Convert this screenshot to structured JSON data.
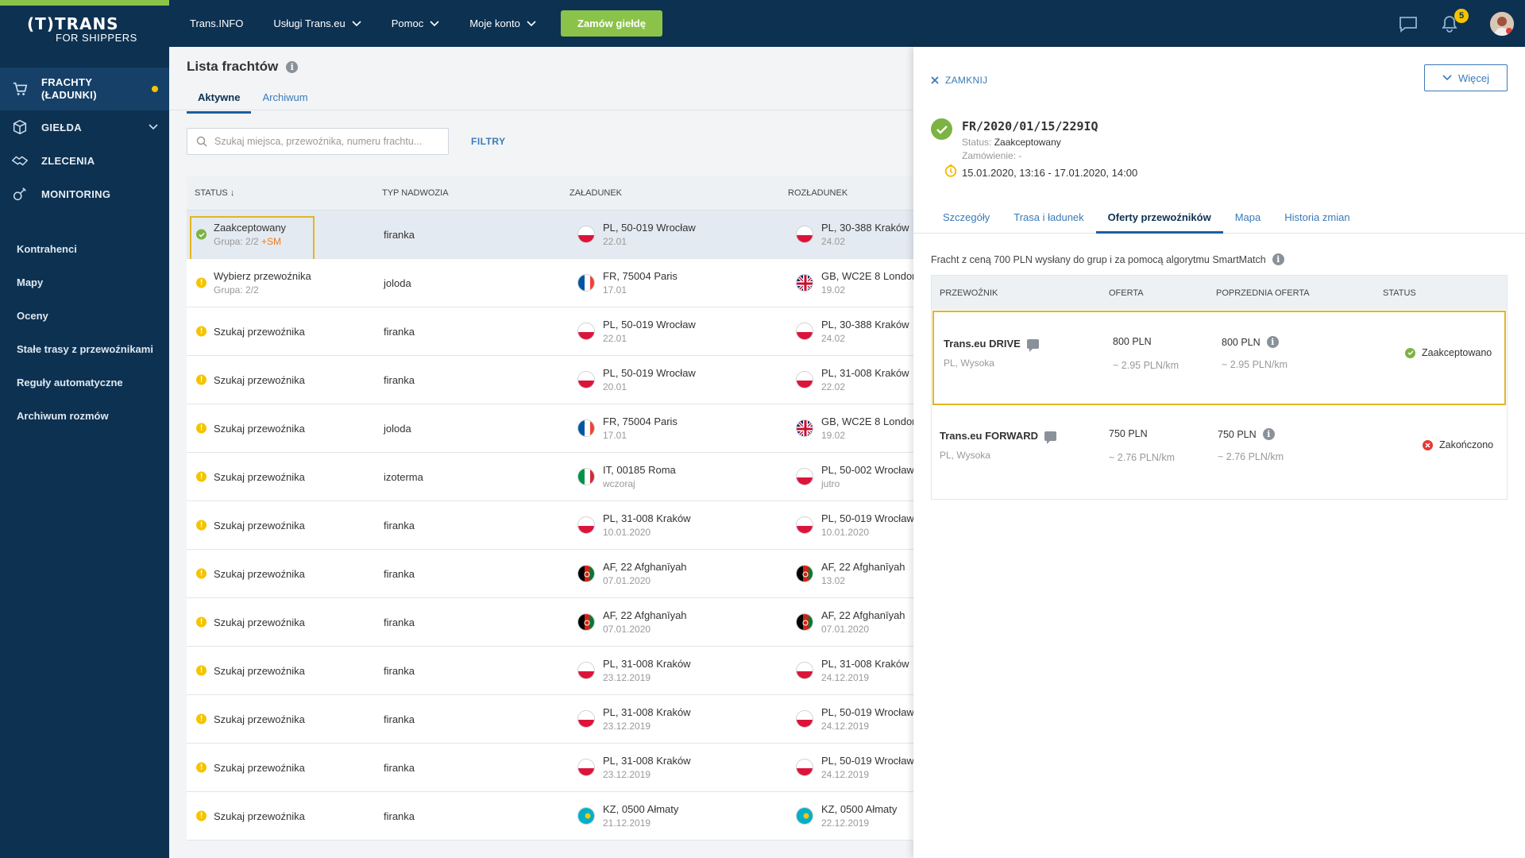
{
  "app": {
    "logo_main": "(T)TRANS",
    "logo_sub": "FOR SHIPPERS"
  },
  "topbar": {
    "nav": [
      {
        "label": "Trans.INFO",
        "has_menu": false
      },
      {
        "label": "Usługi Trans.eu",
        "has_menu": true
      },
      {
        "label": "Pomoc",
        "has_menu": true
      },
      {
        "label": "Moje konto",
        "has_menu": true
      }
    ],
    "order_button": "Zamów giełdę",
    "notifications_count": "5"
  },
  "sidebar": {
    "main": [
      {
        "label": "FRACHTY (ŁADUNKI)",
        "icon": "cart-icon",
        "active": true
      },
      {
        "label": "GIEŁDA",
        "icon": "box-icon"
      },
      {
        "label": "ZLECENIA",
        "icon": "handshake-icon"
      },
      {
        "label": "MONITORING",
        "icon": "satellite-icon"
      }
    ],
    "sub": [
      "Kontrahenci",
      "Mapy",
      "Oceny",
      "Stałe trasy z przewoźnikami",
      "Reguły automatyczne",
      "Archiwum rozmów"
    ]
  },
  "list": {
    "title": "Lista frachtów",
    "tabs": [
      "Aktywne",
      "Archiwum"
    ],
    "search_placeholder": "Szukaj miejsca, przewoźnika, numeru frachtu...",
    "filters_label": "FILTRY",
    "columns": [
      "STATUS ↓",
      "TYP NADWOZIA",
      "ZAŁADUNEK",
      "ROZŁADUNEK"
    ],
    "rows": [
      {
        "status": "Zaakceptowany",
        "group": "Grupa: 2/2",
        "sm": " +SM",
        "ok": true,
        "body": "firanka",
        "from_flag": "PL",
        "from": "PL, 50-019 Wrocław",
        "from_date": "22.01",
        "to_flag": "PL",
        "to": "PL, 30-388 Kraków",
        "to_date": "24.02"
      },
      {
        "status": "Wybierz przewoźnika",
        "group": "Grupa: 2/2",
        "sm": "",
        "ok": false,
        "body": "joloda",
        "from_flag": "FR",
        "from": "FR, 75004 Paris",
        "from_date": "17.01",
        "to_flag": "GB",
        "to": "GB, WC2E 8 London",
        "to_date": "19.02"
      },
      {
        "status": "Szukaj przewoźnika",
        "group": "",
        "sm": "",
        "ok": false,
        "body": "firanka",
        "from_flag": "PL",
        "from": "PL, 50-019 Wrocław",
        "from_date": "22.01",
        "to_flag": "PL",
        "to": "PL, 30-388 Kraków",
        "to_date": "24.02"
      },
      {
        "status": "Szukaj przewoźnika",
        "group": "",
        "sm": "",
        "ok": false,
        "body": "firanka",
        "from_flag": "PL",
        "from": "PL, 50-019 Wrocław",
        "from_date": "20.01",
        "to_flag": "PL",
        "to": "PL, 31-008 Kraków",
        "to_date": "22.02"
      },
      {
        "status": "Szukaj przewoźnika",
        "group": "",
        "sm": "",
        "ok": false,
        "body": "joloda",
        "from_flag": "FR",
        "from": "FR, 75004 Paris",
        "from_date": "17.01",
        "to_flag": "GB",
        "to": "GB, WC2E 8 London",
        "to_date": "19.02"
      },
      {
        "status": "Szukaj przewoźnika",
        "group": "",
        "sm": "",
        "ok": false,
        "body": "izoterma",
        "from_flag": "IT",
        "from": "IT, 00185 Roma",
        "from_date": "wczoraj",
        "to_flag": "PL",
        "to": "PL, 50-002 Wrocław",
        "to_date": "jutro"
      },
      {
        "status": "Szukaj przewoźnika",
        "group": "",
        "sm": "",
        "ok": false,
        "body": "firanka",
        "from_flag": "PL",
        "from": "PL, 31-008 Kraków",
        "from_date": "10.01.2020",
        "to_flag": "PL",
        "to": "PL, 50-019 Wrocław",
        "to_date": "10.01.2020"
      },
      {
        "status": "Szukaj przewoźnika",
        "group": "",
        "sm": "",
        "ok": false,
        "body": "firanka",
        "from_flag": "AF",
        "from": "AF, 22 Afghanīyah",
        "from_date": "07.01.2020",
        "to_flag": "AF",
        "to": "AF, 22 Afghanīyah",
        "to_date": "13.02"
      },
      {
        "status": "Szukaj przewoźnika",
        "group": "",
        "sm": "",
        "ok": false,
        "body": "firanka",
        "from_flag": "AF",
        "from": "AF, 22 Afghanīyah",
        "from_date": "07.01.2020",
        "to_flag": "AF",
        "to": "AF, 22 Afghanīyah",
        "to_date": "07.01.2020"
      },
      {
        "status": "Szukaj przewoźnika",
        "group": "",
        "sm": "",
        "ok": false,
        "body": "firanka",
        "from_flag": "PL",
        "from": "PL, 31-008 Kraków",
        "from_date": "23.12.2019",
        "to_flag": "PL",
        "to": "PL, 31-008 Kraków",
        "to_date": "24.12.2019"
      },
      {
        "status": "Szukaj przewoźnika",
        "group": "",
        "sm": "",
        "ok": false,
        "body": "firanka",
        "from_flag": "PL",
        "from": "PL, 31-008 Kraków",
        "from_date": "23.12.2019",
        "to_flag": "PL",
        "to": "PL, 50-019 Wrocław",
        "to_date": "24.12.2019"
      },
      {
        "status": "Szukaj przewoźnika",
        "group": "",
        "sm": "",
        "ok": false,
        "body": "firanka",
        "from_flag": "PL",
        "from": "PL, 31-008 Kraków",
        "from_date": "23.12.2019",
        "to_flag": "PL",
        "to": "PL, 50-019 Wrocław",
        "to_date": "24.12.2019"
      },
      {
        "status": "Szukaj przewoźnika",
        "group": "",
        "sm": "",
        "ok": false,
        "body": "firanka",
        "from_flag": "KZ",
        "from": "KZ, 0500 Ałmaty",
        "from_date": "21.12.2019",
        "to_flag": "KZ",
        "to": "KZ, 0500 Ałmaty",
        "to_date": "22.12.2019"
      }
    ]
  },
  "panel": {
    "close_label": "ZAMKNIJ",
    "more_label": "Więcej",
    "freight_id": "FR/2020/01/15/229IQ",
    "status_label": "Status:",
    "status_value": "Zaakceptowany",
    "order_label": "Zamówienie: -",
    "dates": "15.01.2020, 13:16 - 17.01.2020, 14:00",
    "tabs": [
      "Szczegóły",
      "Trasa i ładunek",
      "Oferty przewoźników",
      "Mapa",
      "Historia zmian"
    ],
    "active_tab": 2,
    "note": "Fracht z ceną 700 PLN wysłany do grup i za pomocą algorytmu SmartMatch",
    "columns": [
      "PRZEWOŹNIK",
      "OFERTA",
      "POPRZEDNIA OFERTA",
      "STATUS"
    ],
    "offers": [
      {
        "carrier": "Trans.eu DRIVE",
        "location": "PL, Wysoka",
        "offer": "800  PLN",
        "offer_km": "~ 2.95  PLN/km",
        "prev": "800  PLN",
        "prev_km": "~ 2.95  PLN/km",
        "status": "Zaakceptowano",
        "accepted": true
      },
      {
        "carrier": "Trans.eu FORWARD",
        "location": "PL, Wysoka",
        "offer": "750  PLN",
        "offer_km": "~ 2.76  PLN/km",
        "prev": "750  PLN",
        "prev_km": "~ 2.76  PLN/km",
        "status": "Zakończono",
        "accepted": false
      }
    ]
  },
  "colors": {
    "navy": "#0d3151",
    "green": "#8bc34a",
    "accent_blue": "#3a7ab8",
    "highlight": "#e2b622",
    "warning": "#f5c400",
    "error": "#e53935"
  }
}
